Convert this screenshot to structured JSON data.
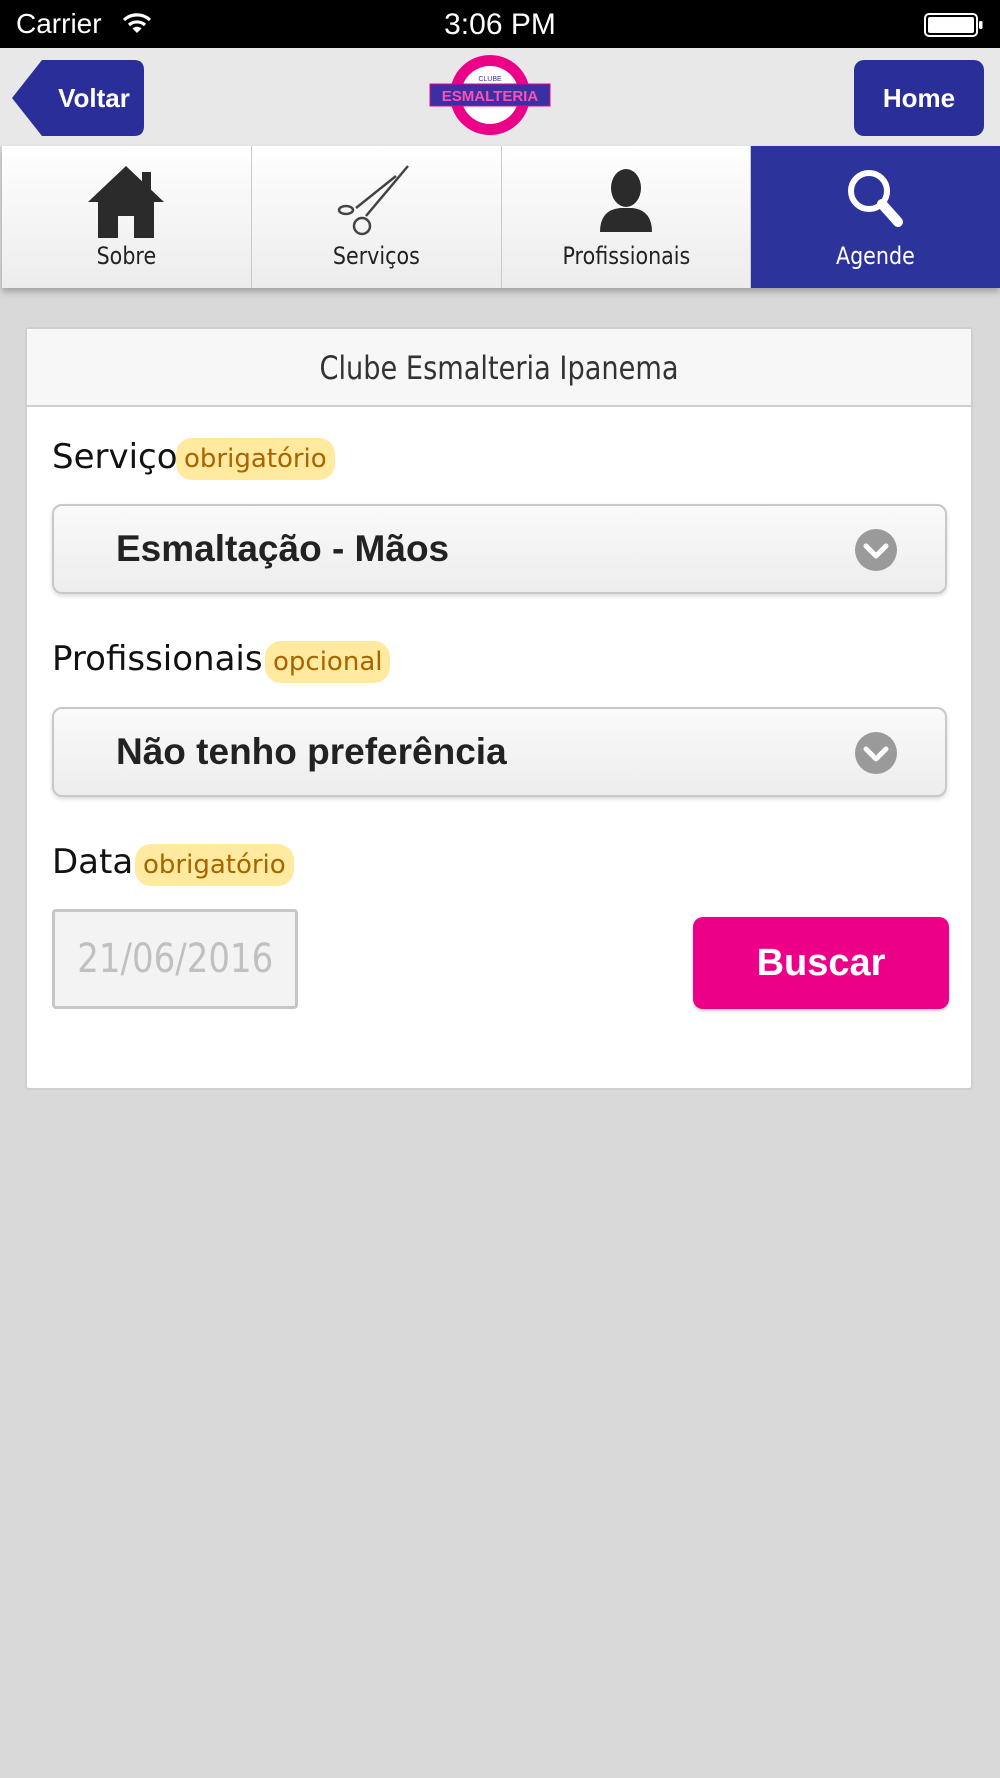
{
  "status_bar": {
    "carrier": "Carrier",
    "time": "3:06 PM"
  },
  "nav": {
    "back_label": "Voltar",
    "home_label": "Home",
    "logo_top_text": "CLUBE",
    "logo_text": "ESMALTERIA"
  },
  "tabs": [
    {
      "label": "Sobre",
      "icon": "home-icon"
    },
    {
      "label": "Serviços",
      "icon": "scissors-icon"
    },
    {
      "label": "Profissionais",
      "icon": "person-icon"
    },
    {
      "label": "Agende",
      "icon": "search-icon",
      "active": true
    }
  ],
  "form": {
    "title": "Clube Esmalteria Ipanema",
    "service": {
      "label": "Serviço",
      "badge": "obrigatório",
      "value": "Esmaltação - Mãos"
    },
    "professionals": {
      "label": "Profissionais",
      "badge": "opcional",
      "value": "Não tenho preferência"
    },
    "date": {
      "label": "Data",
      "badge": "obrigatório",
      "placeholder": "21/06/2016"
    },
    "search_label": "Buscar"
  },
  "colors": {
    "brand_blue": "#2c349c",
    "brand_pink": "#ec0088",
    "badge_bg": "#ffeaa0",
    "badge_text": "#a86400"
  }
}
